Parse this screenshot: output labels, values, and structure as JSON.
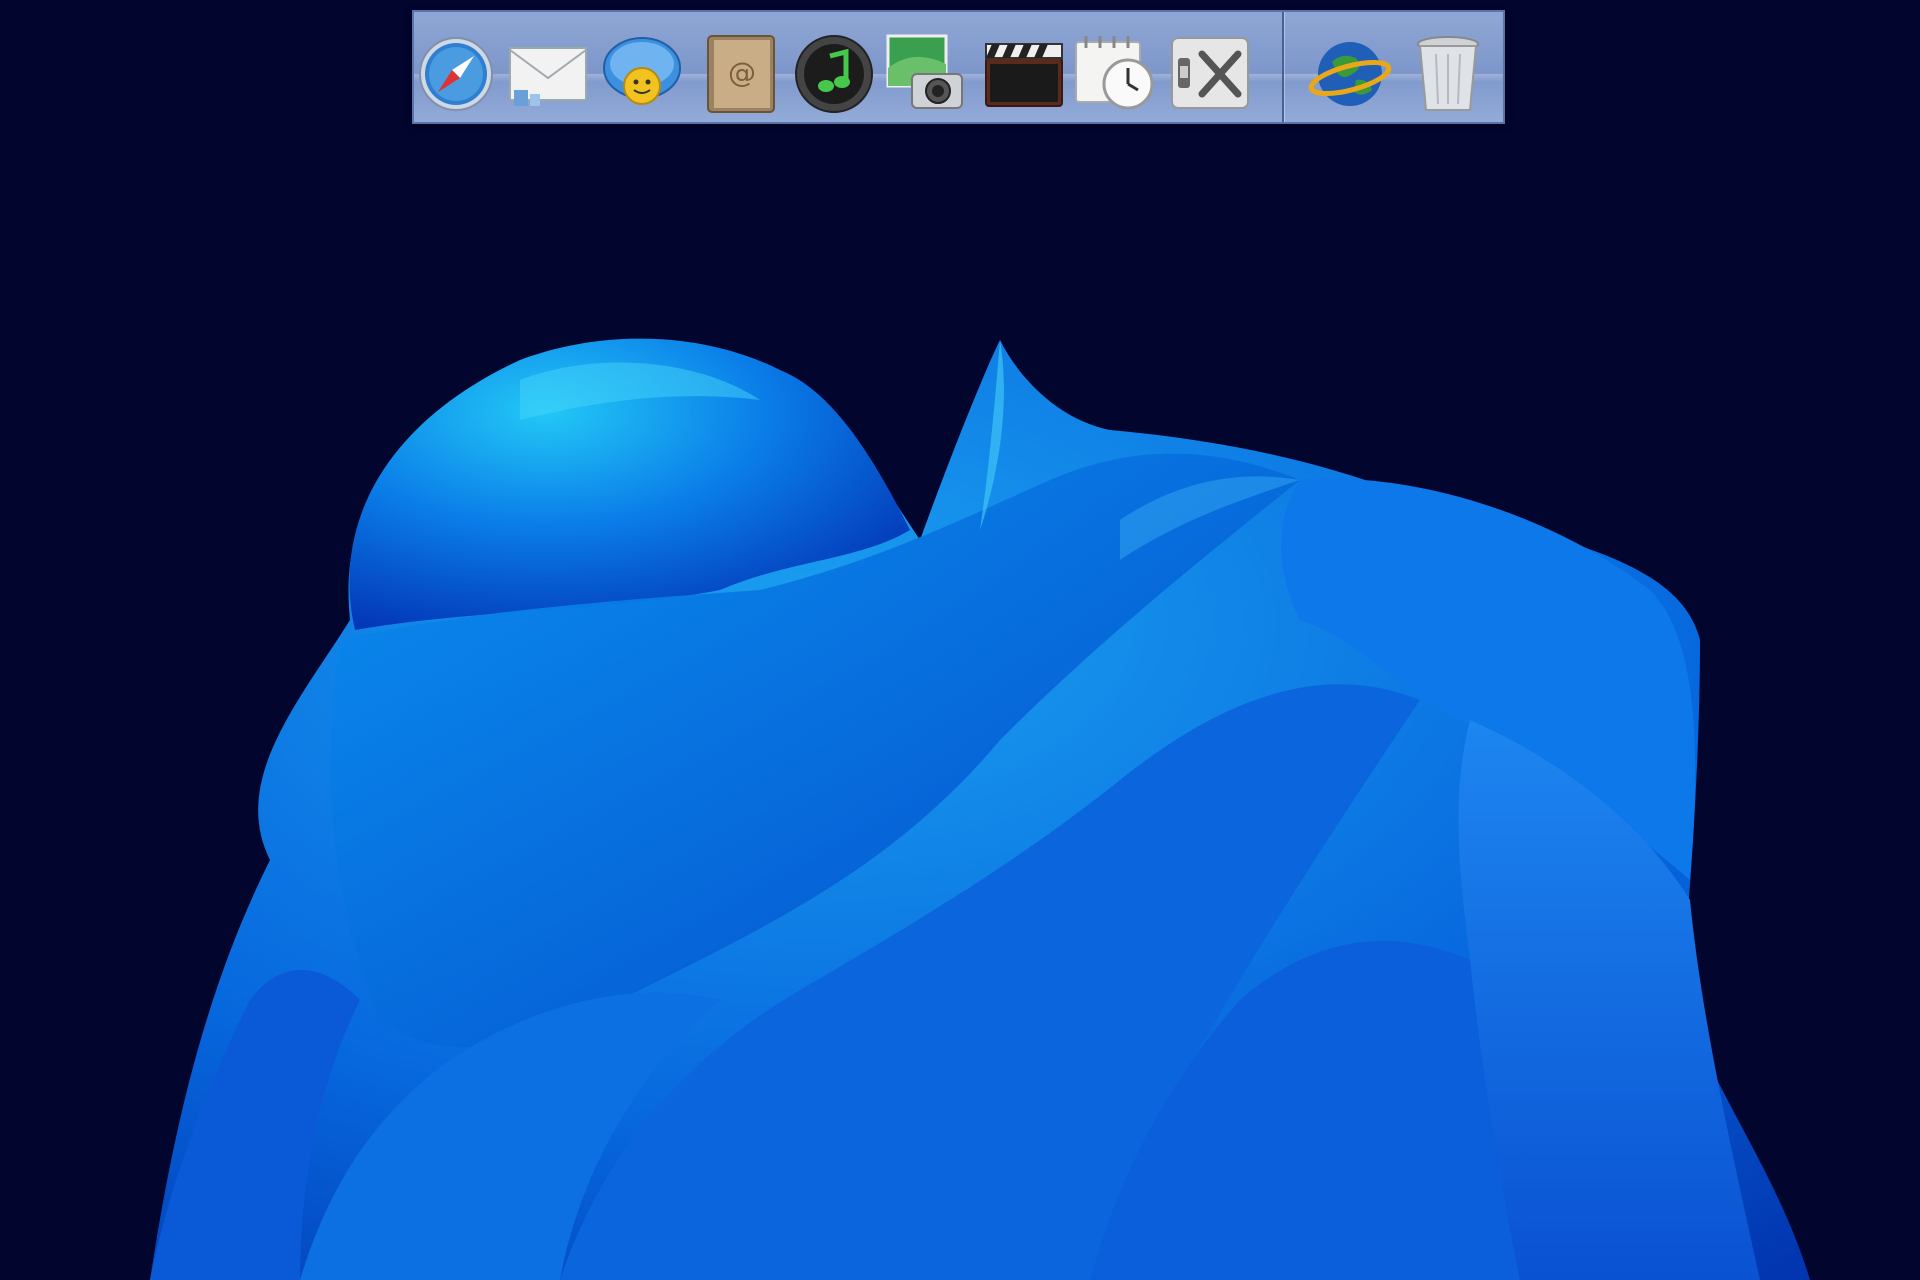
{
  "desktop": {
    "background_color": "#02052e",
    "wallpaper": "blue-abstract-fabric-bloom"
  },
  "dock": {
    "background_color": "#8fa7d4",
    "apps": [
      {
        "icon": "safari-compass-icon"
      },
      {
        "icon": "mail-envelope-icon"
      },
      {
        "icon": "chat-bubble-icon"
      },
      {
        "icon": "address-book-icon"
      },
      {
        "icon": "music-note-icon"
      },
      {
        "icon": "photo-camera-icon"
      },
      {
        "icon": "movie-clapper-icon"
      },
      {
        "icon": "calendar-clock-icon"
      },
      {
        "icon": "system-preferences-tools-icon"
      }
    ],
    "trailing": [
      {
        "icon": "globe-network-icon"
      },
      {
        "icon": "trash-can-icon"
      }
    ]
  }
}
